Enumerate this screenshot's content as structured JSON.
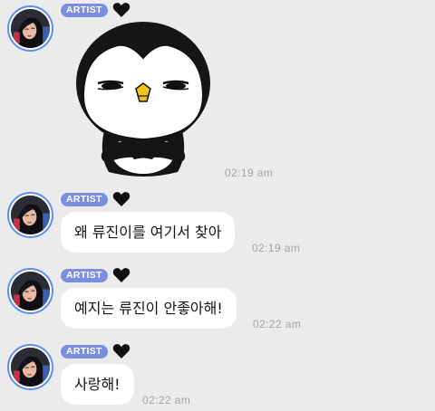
{
  "conversation": {
    "messages": [
      {
        "badge": "ARTIST",
        "heart_icon": "black-heart-icon",
        "kind": "sticker",
        "sticker": "smug-penguin-sticker",
        "time": "02:19 am"
      },
      {
        "badge": "ARTIST",
        "heart_icon": "black-heart-icon",
        "kind": "text",
        "text": "왜 류진이를 여기서 찾아",
        "time": "02:19 am"
      },
      {
        "badge": "ARTIST",
        "heart_icon": "black-heart-icon",
        "kind": "text",
        "text": "예지는 류진이 안좋아해!",
        "time": "02:22 am"
      },
      {
        "badge": "ARTIST",
        "heart_icon": "black-heart-icon",
        "kind": "text",
        "text": "사랑해!",
        "time": "02:22 am"
      }
    ]
  },
  "colors": {
    "background": "#ebebeb",
    "bubble": "#ffffff",
    "badge": "#7b8ee0",
    "avatar_ring": "#5d8ff0",
    "timestamp": "#a4a4a4",
    "text": "#141414"
  }
}
